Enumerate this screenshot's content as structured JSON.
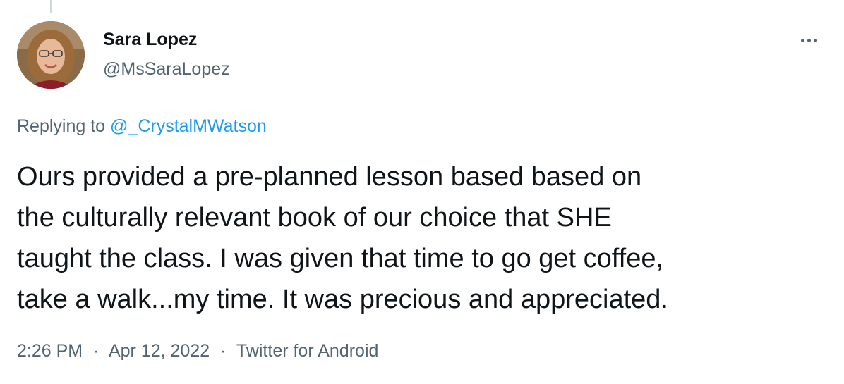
{
  "tweet": {
    "author": {
      "display_name": "Sara Lopez",
      "handle": "@MsSaraLopez"
    },
    "reply": {
      "prefix": "Replying to",
      "to_handle": "@_CrystalMWatson"
    },
    "text": "Ours provided a pre-planned lesson based based on\nthe culturally relevant book of our choice that SHE\ntaught the class. I was given that time to go get coffee,\ntake a walk...my time. It was precious and appreciated.",
    "meta": {
      "time": "2:26 PM",
      "date": "Apr 12, 2022",
      "source": "Twitter for Android",
      "separator": "·"
    },
    "more_icon": "ellipsis-icon"
  },
  "colors": {
    "text_primary": "#0f1419",
    "text_secondary": "#536471",
    "link": "#1d9bf0",
    "thread_line": "#cfd9de"
  }
}
